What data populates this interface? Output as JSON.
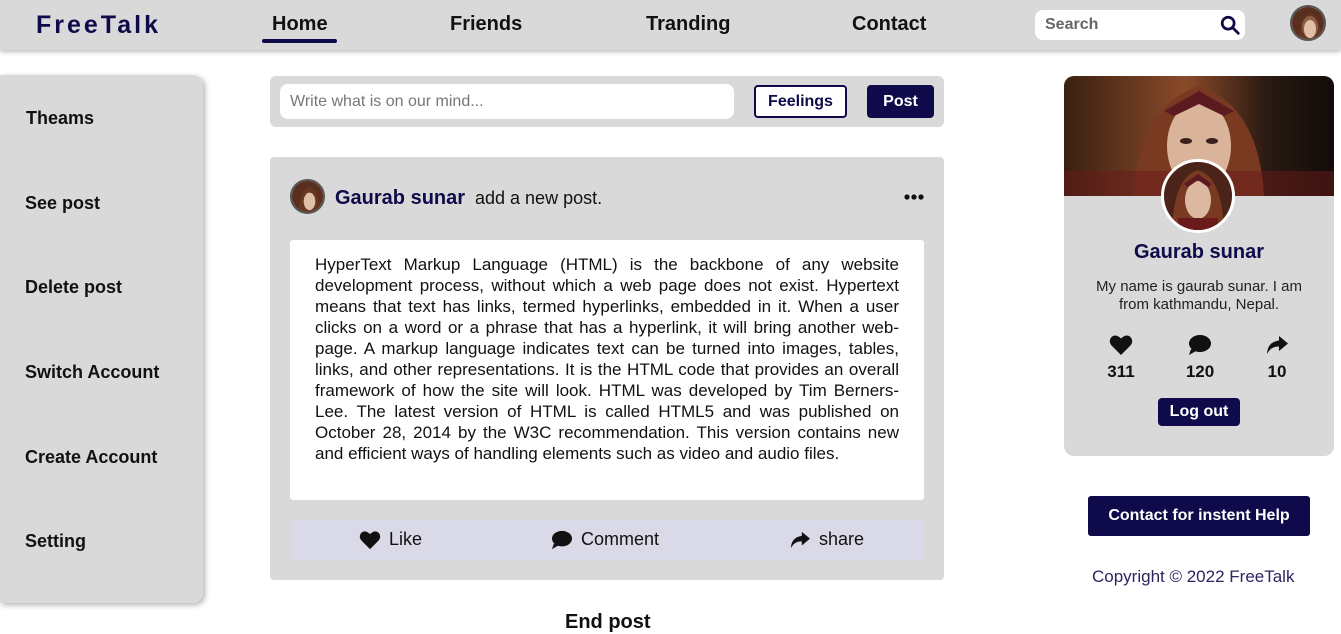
{
  "header": {
    "logo": "FreeTalk",
    "nav": [
      "Home",
      "Friends",
      "Tranding",
      "Contact"
    ],
    "active_nav": "Home",
    "search_placeholder": "Search",
    "search_icon": "search-icon"
  },
  "sidebar": {
    "items": [
      {
        "label": "Theams"
      },
      {
        "label": "See post"
      },
      {
        "label": "Delete post"
      },
      {
        "label": "Switch Account"
      },
      {
        "label": "Create Account"
      },
      {
        "label": "Setting"
      }
    ]
  },
  "composer": {
    "placeholder": "Write what is on our mind...",
    "feelings_label": "Feelings",
    "post_label": "Post"
  },
  "post": {
    "author": "Gaurab sunar",
    "action": "add a new post.",
    "body": "HyperText Markup Language (HTML) is the backbone of any website development process, without which a web page does not exist. Hypertext means that text has links, termed hyperlinks, embedded in it. When a user clicks on a word or a phrase that has a hyperlink, it will bring another web-page. A markup language indicates text can be turned into images, tables, links, and other representations. It is the HTML code that provides an overall framework of how the site will look. HTML was developed by Tim Berners-Lee. The latest version of HTML is called HTML5 and was published on October 28, 2014 by the W3C recommendation. This version contains new and efficient ways of handling elements such as video and audio files.",
    "like_label": "Like",
    "comment_label": "Comment",
    "share_label": "share"
  },
  "end_post": "End post",
  "profile": {
    "name": "Gaurab sunar",
    "bio": "My name is gaurab sunar. I am from kathmandu, Nepal.",
    "likes": "311",
    "comments": "120",
    "shares": "10",
    "logout_label": "Log out"
  },
  "help_label": "Contact for instent Help",
  "copyright": "Copyright © 2022 FreeTalk",
  "colors": {
    "brand": "#0f0a4a",
    "panel": "#d9d9d9",
    "action_bar": "#dad9e8"
  }
}
